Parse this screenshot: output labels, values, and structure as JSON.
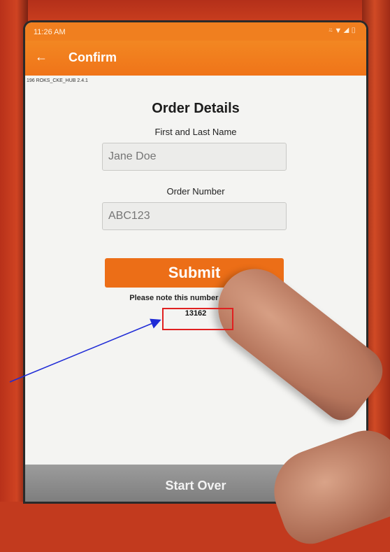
{
  "status_bar": {
    "time": "11:26 AM",
    "icons": [
      "headphones-icon",
      "wifi-icon",
      "signal-icon",
      "battery-icon"
    ]
  },
  "app_bar": {
    "back_icon": "arrow-left-icon",
    "title": "Confirm"
  },
  "version_text": "196 ROKS_CKE_HUB 2.4.1",
  "form": {
    "heading": "Order Details",
    "name_label": "First and Last Name",
    "name_placeholder": "Jane Doe",
    "order_label": "Order Number",
    "order_placeholder": "ABC123",
    "submit_label": "Submit",
    "note": "Please note this number before final",
    "order_code": "13162"
  },
  "footer": {
    "start_over_label": "Start Over"
  },
  "colors": {
    "accent": "#f07f1f",
    "submit": "#ec6e17",
    "annotation_box": "#e02020",
    "annotation_arrow": "#1f2bd6"
  }
}
